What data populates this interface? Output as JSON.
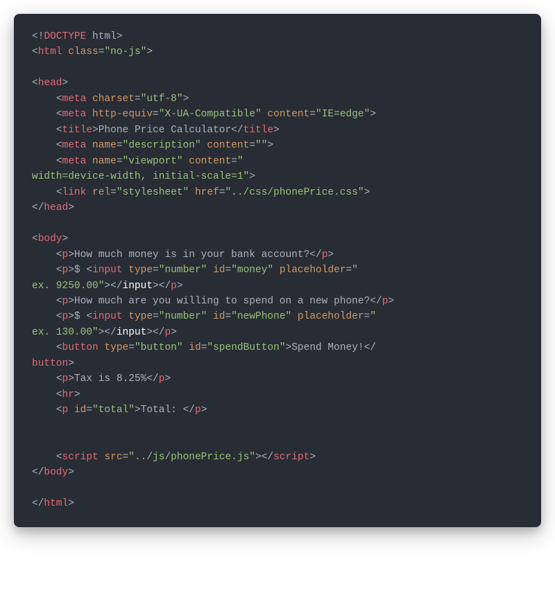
{
  "code": {
    "l1": {
      "open": "<!",
      "doctype": "DOCTYPE",
      "rest": " html",
      "close": ">"
    },
    "l2": {
      "tag": "html",
      "attr": "class",
      "val": "\"no-js\""
    },
    "l4": {
      "tag": "head"
    },
    "l5": {
      "tag": "meta",
      "attr": "charset",
      "val": "\"utf-8\""
    },
    "l6": {
      "tag": "meta",
      "attr1": "http-equiv",
      "val1": "\"X-UA-Compatible\"",
      "attr2": "content",
      "val2": "\"IE=edge\""
    },
    "l7": {
      "tag": "title",
      "text": "Phone Price Calculator"
    },
    "l8": {
      "tag": "meta",
      "attr1": "name",
      "val1": "\"description\"",
      "attr2": "content",
      "val2": "\"\""
    },
    "l9": {
      "tag": "meta",
      "attr1": "name",
      "val1": "\"viewport\"",
      "attr2": "content",
      "val2_open": "\"",
      "val2_wrap": "width=device-width, initial-scale=1\""
    },
    "l10": {
      "tag": "link",
      "attr1": "rel",
      "val1": "\"stylesheet\"",
      "attr2": "href",
      "val2": "\"../css/phonePrice.css\""
    },
    "l11": {
      "tag": "head"
    },
    "l13": {
      "tag": "body"
    },
    "l14": {
      "tag": "p",
      "text": "How much money is in your bank account?"
    },
    "l15": {
      "tag": "p",
      "dollar": "$ ",
      "in_tag": "input",
      "a_type": "type",
      "v_type": "\"number\"",
      "a_id": "id",
      "v_id": "\"money\"",
      "a_ph": "placeholder",
      "v_ph_open": "\"",
      "v_ph_wrap": "ex. 9250.00\"",
      "close_input": "input"
    },
    "l16": {
      "tag": "p",
      "text": "How much are you willing to spend on a new phone?"
    },
    "l17": {
      "tag": "p",
      "dollar": "$ ",
      "in_tag": "input",
      "a_type": "type",
      "v_type": "\"number\"",
      "a_id": "id",
      "v_id": "\"newPhone\"",
      "a_ph": "placeholder",
      "v_ph_open": "\"",
      "v_ph_wrap": "ex. 130.00\"",
      "close_input": "input"
    },
    "l18": {
      "tag": "button",
      "a_type": "type",
      "v_type": "\"button\"",
      "a_id": "id",
      "v_id": "\"spendButton\"",
      "text": "Spend Money!"
    },
    "l19": {
      "tag": "p",
      "text": "Tax is 8.25%"
    },
    "l20": {
      "tag": "hr"
    },
    "l21": {
      "tag": "p",
      "a_id": "id",
      "v_id": "\"total\"",
      "text": "Total: "
    },
    "l23": {
      "tag": "script",
      "attr": "src",
      "val": "\"../js/phonePrice.js\""
    },
    "l24": {
      "tag": "body"
    },
    "l26": {
      "tag": "html"
    }
  }
}
